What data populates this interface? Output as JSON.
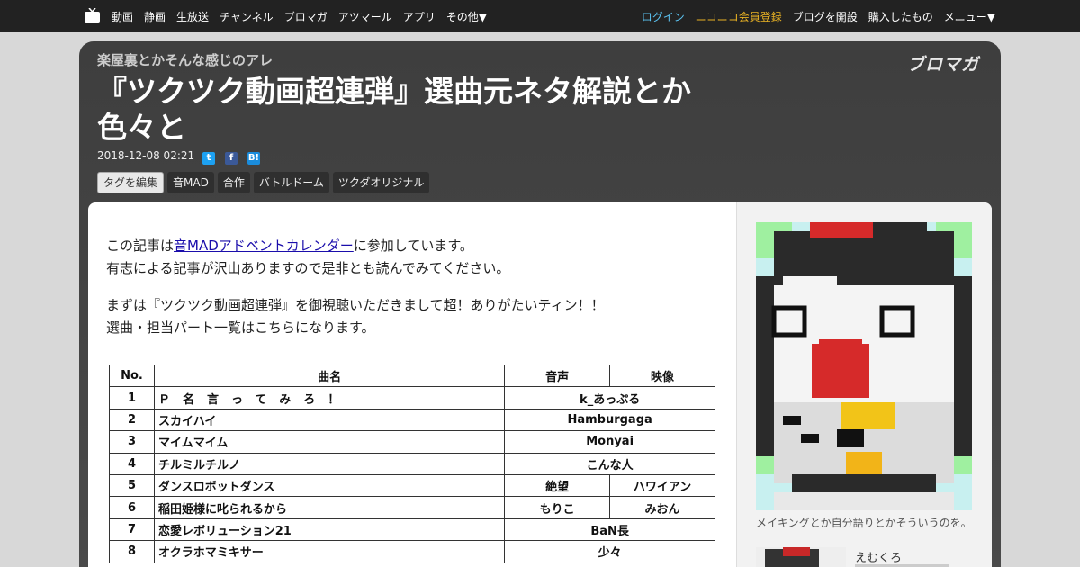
{
  "nav": {
    "left": [
      "動画",
      "静画",
      "生放送",
      "チャンネル",
      "ブロマガ",
      "アツマール",
      "アプリ",
      "その他▼"
    ],
    "login": "ログイン",
    "premium": "ニコニコ会員登録",
    "right": [
      "ブログを開設",
      "購入したもの",
      "メニュー▼"
    ]
  },
  "header": {
    "channel": "楽屋裏とかそんな感じのアレ",
    "title": "『ツクツク動画超連弾』選曲元ネタ解説とか色々と",
    "brand": "ブロマガ",
    "date": "2018-12-08 02:21",
    "share": {
      "twitter": "t",
      "facebook": "f",
      "hatena": "B!"
    },
    "edit_tags": "タグを編集",
    "tags": [
      "音MAD",
      "合作",
      "バトルドーム",
      "ツクダオリジナル"
    ]
  },
  "article": {
    "p1_pre": "この記事は",
    "p1_link": "音MADアドベントカレンダー",
    "p1_post": "に参加しています。",
    "p2": "有志による記事が沢山ありますので是非とも読んでみてください。",
    "p3": "まずは『ツクツク動画超連弾』を御視聴いただきまして超！ありがたいティン！！",
    "p4": "選曲・担当パート一覧はこちらになります。"
  },
  "table": {
    "headers": [
      "No.",
      "曲名",
      "音声",
      "映像"
    ],
    "rows": [
      {
        "no": "1",
        "name": "Ｐ名言ってみろ！",
        "voice": "k_あっぷる",
        "video": ""
      },
      {
        "no": "2",
        "name": "スカイハイ",
        "voice": "Hamburgaga",
        "video": ""
      },
      {
        "no": "3",
        "name": "マイムマイム",
        "voice": "Monyai",
        "video": ""
      },
      {
        "no": "4",
        "name": "チルミルチルノ",
        "voice": "こんな人",
        "video": ""
      },
      {
        "no": "5",
        "name": "ダンスロボットダンス",
        "voice": "絶望",
        "video": "ハワイアン"
      },
      {
        "no": "6",
        "name": "稲田姫様に叱られるから",
        "voice": "もりこ",
        "video": "みおん"
      },
      {
        "no": "7",
        "name": "恋愛レボリューション21",
        "voice": "BaN長",
        "video": ""
      },
      {
        "no": "8",
        "name": "オクラホマミキサー",
        "voice": "少々",
        "video": ""
      }
    ]
  },
  "sidebar": {
    "caption": "メイキングとか自分語りとかそういうのを。",
    "author": "えむくろ"
  }
}
